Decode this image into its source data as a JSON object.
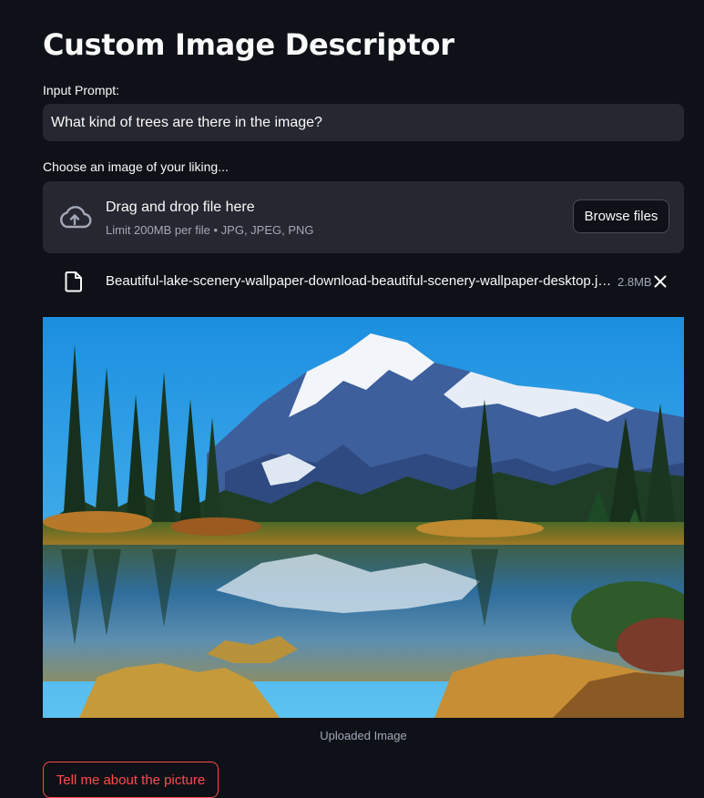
{
  "page": {
    "title": "Custom Image Descriptor"
  },
  "prompt": {
    "label": "Input Prompt:",
    "value": "What kind of trees are there in the image?"
  },
  "uploader": {
    "label": "Choose an image of your liking...",
    "drop_title": "Drag and drop file here",
    "limit_text": "Limit 200MB per file • JPG, JPEG, PNG",
    "browse_label": "Browse files",
    "icon": "cloud-upload-icon"
  },
  "file": {
    "name": "Beautiful-lake-scenery-wallpaper-download-beautiful-scenery-wallpaper-desktop.jpg",
    "size": "2.8MB",
    "icon": "file-icon",
    "remove_icon": "close-icon"
  },
  "image": {
    "caption": "Uploaded Image"
  },
  "actions": {
    "submit_label": "Tell me about the picture"
  },
  "colors": {
    "background": "#0e1117",
    "widget_bg": "#262730",
    "text": "#fafafa",
    "muted_text": "#a3a8b8",
    "accent": "#ff4b4b"
  }
}
